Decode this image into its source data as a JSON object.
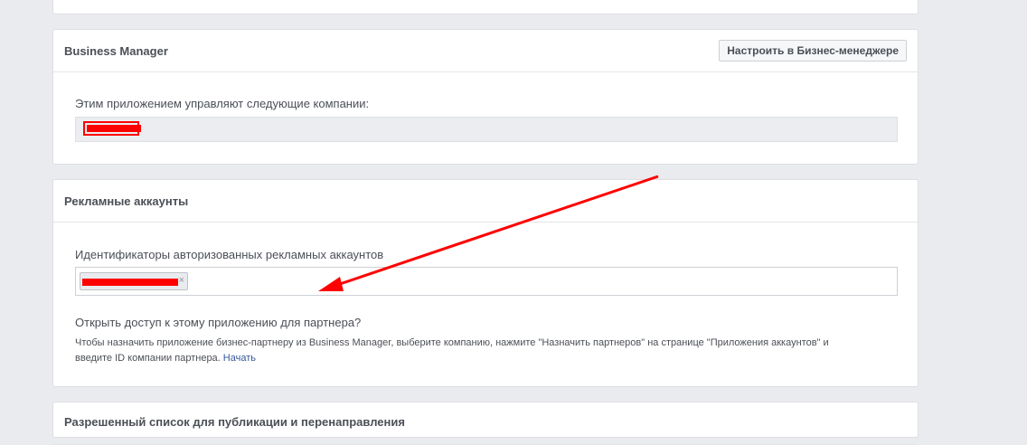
{
  "business_manager": {
    "title": "Business Manager",
    "configure_button": "Настроить в Бизнес-менеджере",
    "companies_label": "Этим приложением управляют следующие компании:"
  },
  "ad_accounts": {
    "title": "Рекламные аккаунты",
    "ids_label": "Идентификаторы авторизованных рекламных аккаунтов",
    "remove_token": "×",
    "share_question": "Открыть доступ к этому приложению для партнера?",
    "help_text": "Чтобы назначить приложение бизнес-партнеру из Business Manager, выберите компанию, нажмите \"Назначить партнеров\" на странице \"Приложения аккаунтов\" и введите ID компании партнера.",
    "start_link": "Начать"
  },
  "allowlist": {
    "title": "Разрешенный список для публикации и перенаправления"
  },
  "colors": {
    "annotation_red": "#ff0000",
    "link_blue": "#365899",
    "page_bg": "#e9ebee"
  }
}
